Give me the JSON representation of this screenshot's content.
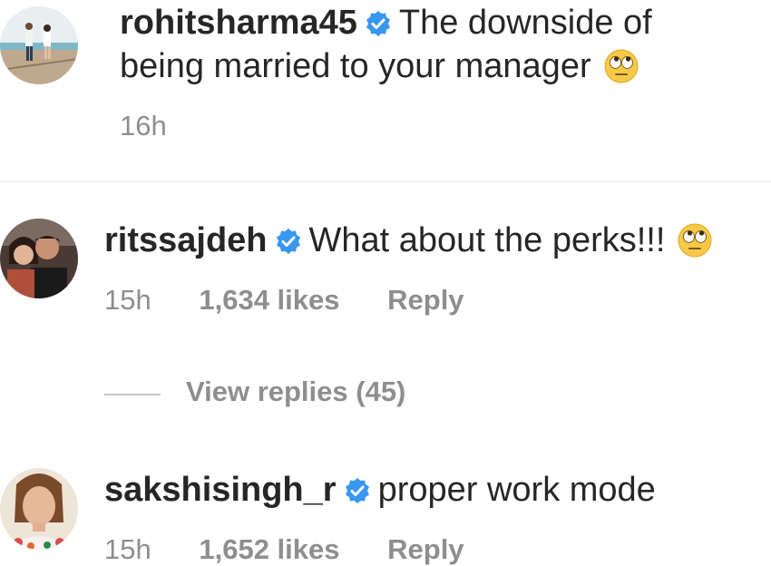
{
  "comments": [
    {
      "username": "rohitsharma45",
      "text_line1": "The downside of",
      "text_line2": "being married to your manager",
      "emoji": "face-with-rolling-eyes",
      "time": "16h"
    },
    {
      "username": "ritssajdeh",
      "text": "What about the perks!!!",
      "emoji": "face-with-rolling-eyes",
      "time": "15h",
      "likes": "1,634 likes",
      "reply": "Reply"
    },
    {
      "username": "sakshisingh_r",
      "text": "proper work mode",
      "time": "15h",
      "likes": "1,652 likes",
      "reply": "Reply"
    }
  ],
  "view_replies": "View replies (45)",
  "colors": {
    "text": "#262626",
    "meta": "#8e8e8e",
    "verified": "#3897f0"
  },
  "icons": [
    "verified-badge-icon",
    "rolling-eyes-emoji-icon",
    "avatar-image"
  ]
}
